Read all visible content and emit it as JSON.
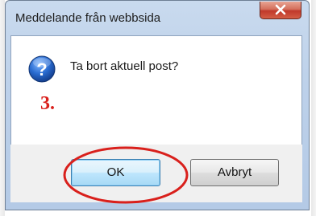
{
  "dialog": {
    "title": "Meddelande från webbsida",
    "message": "Ta bort aktuell post?",
    "icon": "question-icon",
    "close_icon": "close-icon"
  },
  "annotation": {
    "step_label": "3.",
    "highlight_color": "#d9201c"
  },
  "buttons": {
    "ok_label": "OK",
    "cancel_label": "Avbryt"
  },
  "colors": {
    "accent": "#2b6fc4",
    "close_red": "#c0392b"
  }
}
